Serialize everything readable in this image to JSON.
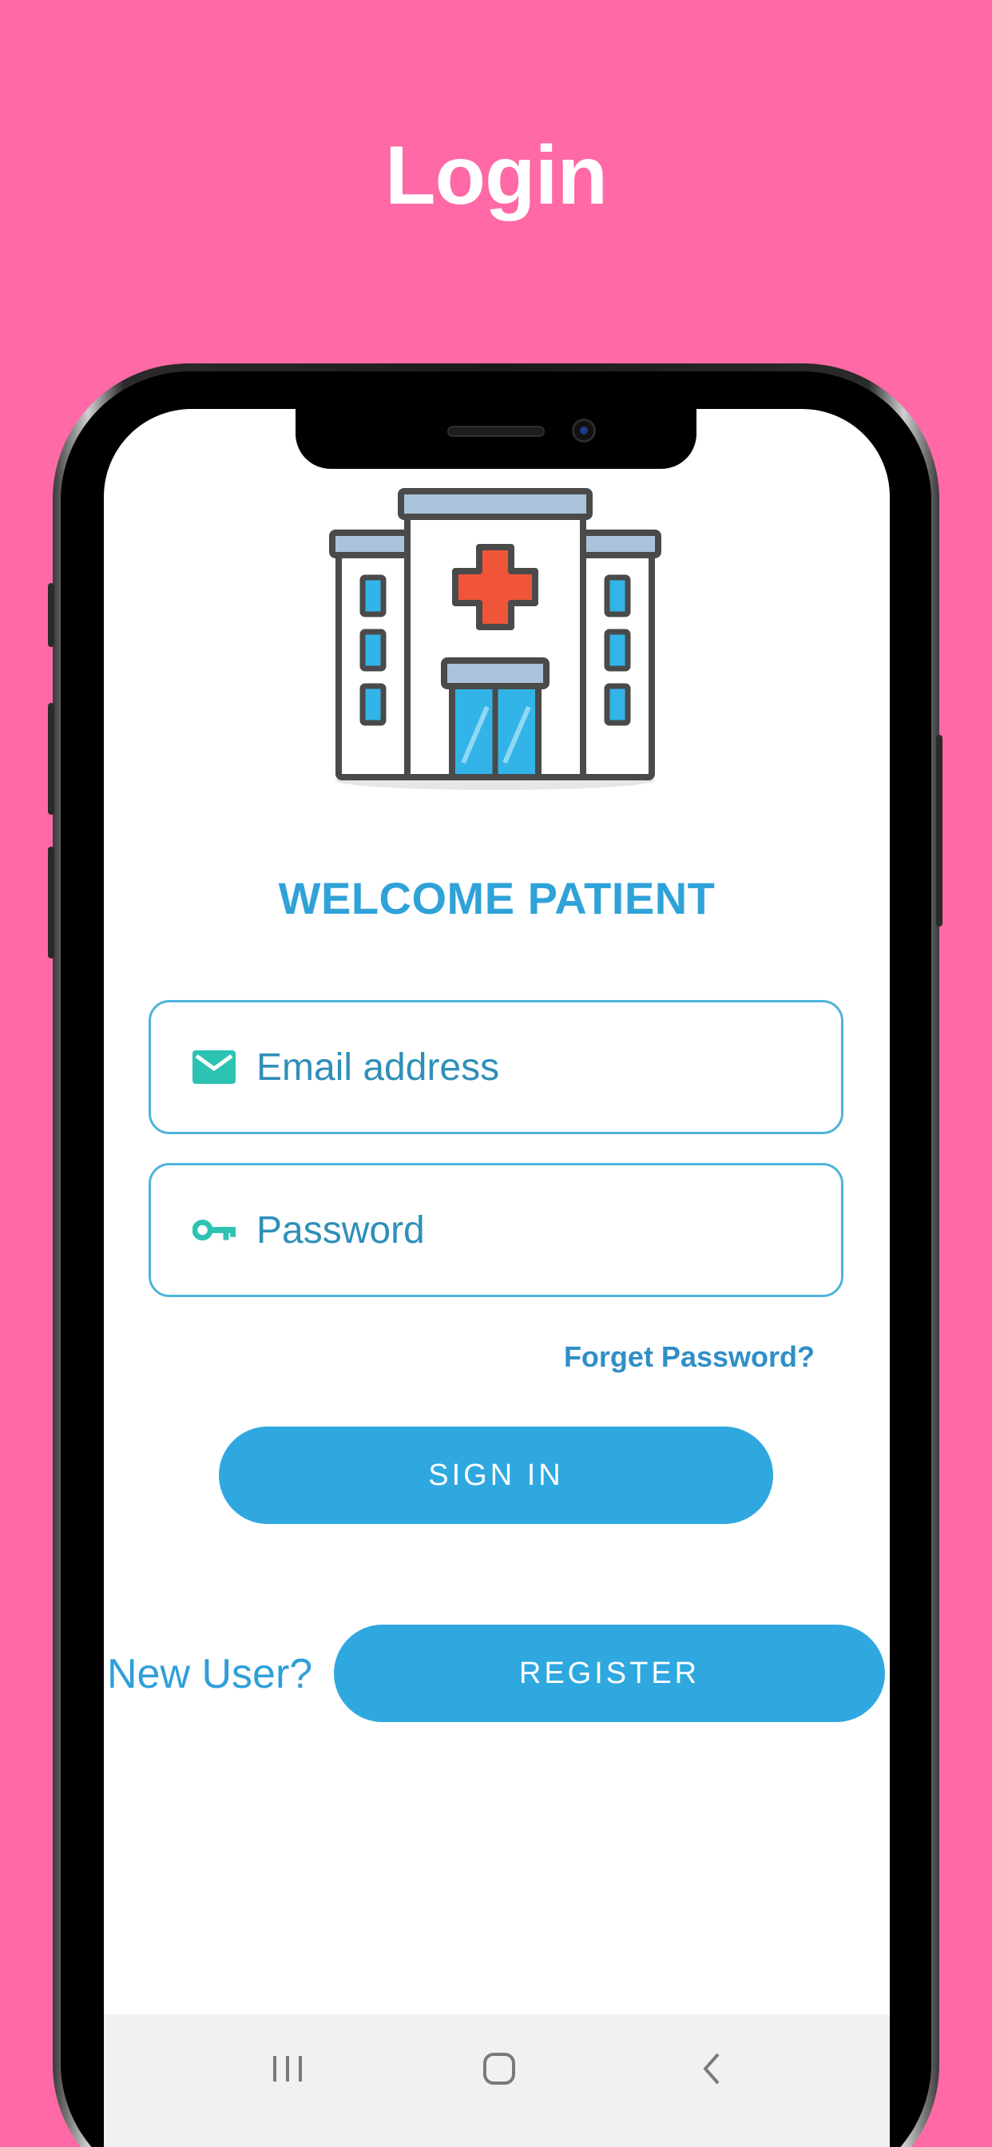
{
  "page": {
    "title": "Login"
  },
  "app": {
    "welcome_text": "WELCOME PATIENT",
    "email": {
      "placeholder": "Email address"
    },
    "password": {
      "placeholder": "Password"
    },
    "forget_password": "Forget Password?",
    "sign_in_label": "SIGN IN",
    "new_user_label": "New User?",
    "register_label": "REGISTER"
  },
  "icons": {
    "email": "mail-icon",
    "password": "key-icon",
    "logo": "hospital-icon"
  },
  "colors": {
    "background": "#FF69A5",
    "accent": "#2FA8E0",
    "icon_teal": "#2CC3B3",
    "cross_red": "#F0553A"
  }
}
